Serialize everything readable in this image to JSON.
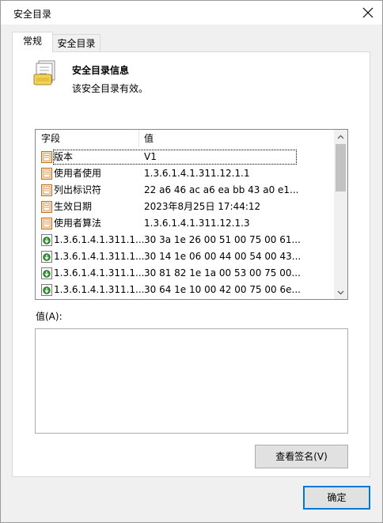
{
  "window": {
    "title": "安全目录"
  },
  "tabs": [
    {
      "label": "常规"
    },
    {
      "label": "安全目录"
    }
  ],
  "info": {
    "title": "安全目录信息",
    "description": "该安全目录有效。"
  },
  "list": {
    "columns": [
      "字段",
      "值"
    ],
    "rows": [
      {
        "icon": "document-field-icon",
        "field": "版本",
        "value": "V1"
      },
      {
        "icon": "document-field-icon",
        "field": "使用者使用",
        "value": "1.3.6.1.4.1.311.12.1.1"
      },
      {
        "icon": "document-field-icon",
        "field": "列出标识符",
        "value": "22 a6 46 ac a6 ea bb 43 a0 e1..."
      },
      {
        "icon": "document-field-icon",
        "field": "生效日期",
        "value": "2023年8月25日 17:44:12"
      },
      {
        "icon": "document-field-icon",
        "field": "使用者算法",
        "value": "1.3.6.1.4.1.311.12.1.3"
      },
      {
        "icon": "extension-download-icon",
        "field": "1.3.6.1.4.1.311.1...",
        "value": "30 3a 1e 26 00 51 00 75 00 61..."
      },
      {
        "icon": "extension-download-icon",
        "field": "1.3.6.1.4.1.311.1...",
        "value": "30 14 1e 06 00 44 00 54 00 43..."
      },
      {
        "icon": "extension-download-icon",
        "field": "1.3.6.1.4.1.311.1...",
        "value": "30 81 82 1e 1a 00 53 00 75 00..."
      },
      {
        "icon": "extension-download-icon",
        "field": "1.3.6.1.4.1.311.1...",
        "value": "30 64 1e 10 00 42 00 75 00 6e..."
      }
    ]
  },
  "value_field": {
    "label": "值(A):",
    "content": ""
  },
  "buttons": {
    "view_signature": "查看签名(V)",
    "ok": "确定"
  }
}
